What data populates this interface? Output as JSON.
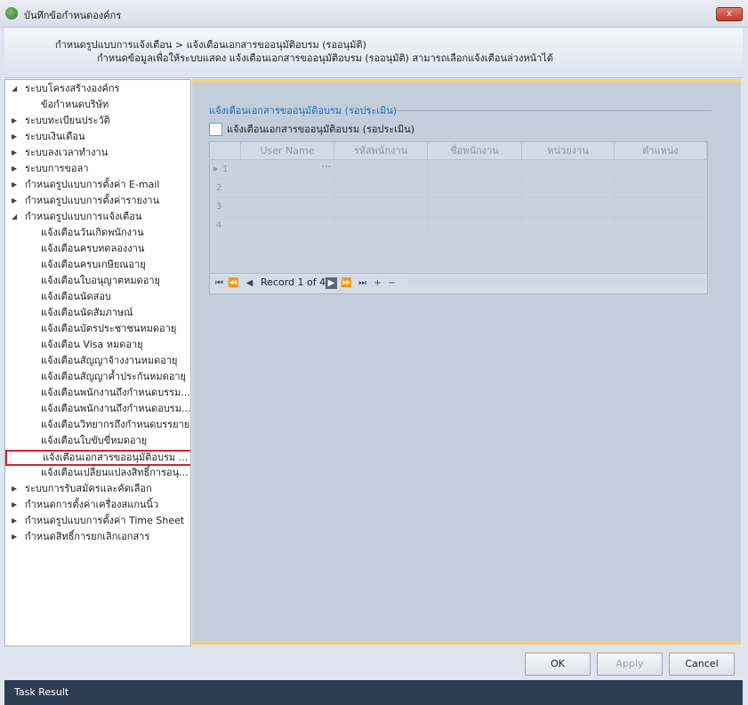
{
  "window": {
    "title": "บันทึกข้อกำหนดองค์กร",
    "close_label": "x"
  },
  "header": {
    "breadcrumb": "กำหนดรูปแบบการแจ้งเตือน > แจ้งเตือนเอกสารขออนุมัติอบรม (รออนุมัติ)",
    "description": "กำหนดข้อมูลเพื่อให้ระบบแสดง แจ้งเตือนเอกสารขออนุมัติอบรม (รออนุมัติ) สามารถเลือกแจ้งเตือนล่วงหน้าได้"
  },
  "tree": {
    "nodes": [
      {
        "label": "ระบบโครงสร้างองค์กร",
        "level": 0,
        "state": "expanded"
      },
      {
        "label": "ข้อกำหนดบริษัท",
        "level": 1
      },
      {
        "label": "ระบบทะเบียนประวัติ",
        "level": 0,
        "state": "collapsed"
      },
      {
        "label": "ระบบเงินเดือน",
        "level": 0,
        "state": "collapsed"
      },
      {
        "label": "ระบบลงเวลาทำงาน",
        "level": 0,
        "state": "collapsed"
      },
      {
        "label": "ระบบการขอลา",
        "level": 0,
        "state": "collapsed"
      },
      {
        "label": "กำหนดรูปแบบการตั้งค่า E-mail",
        "level": 0,
        "state": "collapsed"
      },
      {
        "label": "กำหนดรูปแบบการตั้งค่ารายงาน",
        "level": 0,
        "state": "collapsed"
      },
      {
        "label": "กำหนดรูปแบบการแจ้งเตือน",
        "level": 0,
        "state": "expanded"
      },
      {
        "label": "แจ้งเตือนวันเกิดพนักงาน",
        "level": 1
      },
      {
        "label": "แจ้งเตือนครบทดลองงาน",
        "level": 1
      },
      {
        "label": "แจ้งเตือนครบเกษียณอายุ",
        "level": 1
      },
      {
        "label": "แจ้งเตือนใบอนุญาตหมดอายุ",
        "level": 1
      },
      {
        "label": "แจ้งเตือนนัดสอบ",
        "level": 1
      },
      {
        "label": "แจ้งเตือนนัดสัมภาษณ์",
        "level": 1
      },
      {
        "label": "แจ้งเตือนบัตรประชาชนหมดอายุ",
        "level": 1
      },
      {
        "label": "แจ้งเตือน Visa หมดอายุ",
        "level": 1
      },
      {
        "label": "แจ้งเตือนสัญญาจ้างงานหมดอายุ",
        "level": 1
      },
      {
        "label": "แจ้งเตือนสัญญาค้ำประกันหมดอายุ",
        "level": 1
      },
      {
        "label": "แจ้งเตือนพนักงานถึงกำหนดบรรม...",
        "level": 1
      },
      {
        "label": "แจ้งเตือนพนักงานถึงกำหนดอบรม...",
        "level": 1
      },
      {
        "label": "แจ้งเตือนวิทยากรถึงกำหนดบรรยาย",
        "level": 1
      },
      {
        "label": "แจ้งเตือนใบขับขี่หมดอายุ",
        "level": 1
      },
      {
        "label": "แจ้งเตือนเอกสารขออนุมัติอบรม ...",
        "level": 1,
        "selected": true
      },
      {
        "label": "แจ้งเตือนเปลี่ยนแปลงสิทธิ์การอนุ...",
        "level": 1
      },
      {
        "label": "ระบบการรับสมัครและคัดเลือก",
        "level": 0,
        "state": "collapsed"
      },
      {
        "label": "กำหนดการตั้งค่าเครื่องสแกนนิ้ว",
        "level": 0,
        "state": "collapsed"
      },
      {
        "label": "กำหนดรูปแบบการตั้งค่า Time Sheet",
        "level": 0,
        "state": "collapsed"
      },
      {
        "label": "กำหนดสิทธิ์การยกเลิกเอกสาร",
        "level": 0,
        "state": "collapsed"
      }
    ]
  },
  "main": {
    "section_title": "แจ้งเตือนเอกสารขออนุมัติอบรม (รอประเมิน)",
    "checkbox_label": "แจ้งเตือนเอกสารขออนุมัติอบรม (รอประเมิน)",
    "grid": {
      "columns": [
        "User Name",
        "รหัสพนักงาน",
        "ชื่อพนักงาน",
        "หน่วยงาน",
        "ตำแหน่ง"
      ],
      "rows": [
        "1",
        "2",
        "3",
        "4"
      ],
      "ellipsis": "···",
      "record_text": "Record 1 of 4"
    }
  },
  "footer": {
    "ok": "OK",
    "apply": "Apply",
    "cancel": "Cancel"
  },
  "status_bar": {
    "label": "Task Result"
  }
}
